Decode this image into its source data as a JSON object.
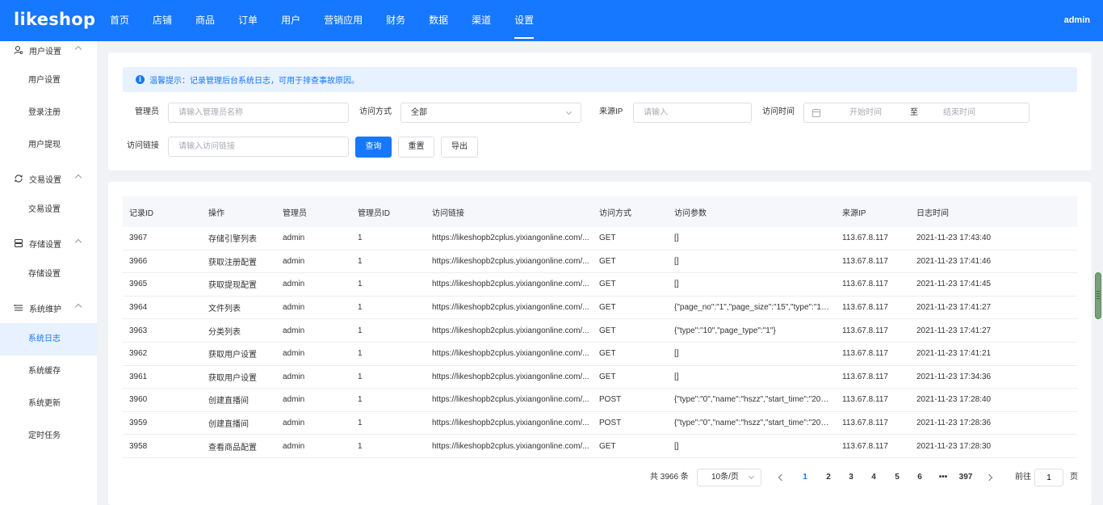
{
  "brand": {
    "logo": "likeshop",
    "accent": "#1677ff"
  },
  "topnav": {
    "items": [
      "首页",
      "店铺",
      "商品",
      "订单",
      "用户",
      "营销应用",
      "财务",
      "数据",
      "渠道",
      "设置"
    ],
    "active": "设置",
    "user": "admin"
  },
  "sidebar": {
    "groups": [
      {
        "label": "用户设置",
        "icon": "user-settings-icon",
        "items": [
          "用户设置",
          "登录注册",
          "用户提现"
        ]
      },
      {
        "label": "交易设置",
        "icon": "sync-icon",
        "items": [
          "交易设置"
        ]
      },
      {
        "label": "存储设置",
        "icon": "database-icon",
        "items": [
          "存储设置"
        ]
      },
      {
        "label": "系统维护",
        "icon": "list-icon",
        "items": [
          "系统日志",
          "系统缓存",
          "系统更新",
          "定时任务"
        ]
      }
    ],
    "active_item": "系统日志"
  },
  "filters": {
    "tip": "温馨提示：记录管理后台系统日志，可用于排查事故原因。",
    "admin_label": "管理员",
    "admin_placeholder": "请输入管理员名称",
    "method_label": "访问方式",
    "method_value": "全部",
    "ip_label": "来源IP",
    "ip_placeholder": "请输入",
    "time_label": "访问时间",
    "time_start": "开始时间",
    "time_sep": "至",
    "time_end": "结束时间",
    "url_label": "访问链接",
    "url_placeholder": "请输入访问链接",
    "search_btn": "查询",
    "reset_btn": "重置",
    "export_btn": "导出"
  },
  "table": {
    "columns": [
      "记录ID",
      "操作",
      "管理员",
      "管理员ID",
      "访问链接",
      "访问方式",
      "访问参数",
      "来源IP",
      "日志时间"
    ],
    "rows": [
      [
        "3967",
        "存储引擎列表",
        "admin",
        "1",
        "https://likeshopb2cplus.yixiangonline.com/...",
        "GET",
        "[]",
        "113.67.8.117",
        "2021-11-23 17:43:40"
      ],
      [
        "3966",
        "获取注册配置",
        "admin",
        "1",
        "https://likeshopb2cplus.yixiangonline.com/...",
        "GET",
        "[]",
        "113.67.8.117",
        "2021-11-23 17:41:46"
      ],
      [
        "3965",
        "获取提现配置",
        "admin",
        "1",
        "https://likeshopb2cplus.yixiangonline.com/...",
        "GET",
        "[]",
        "113.67.8.117",
        "2021-11-23 17:41:45"
      ],
      [
        "3964",
        "文件列表",
        "admin",
        "1",
        "https://likeshopb2cplus.yixiangonline.com/...",
        "GET",
        "{\"page_no\":\"1\",\"page_size\":\"15\",\"type\":\"10...",
        "113.67.8.117",
        "2021-11-23 17:41:27"
      ],
      [
        "3963",
        "分类列表",
        "admin",
        "1",
        "https://likeshopb2cplus.yixiangonline.com/...",
        "GET",
        "{\"type\":\"10\",\"page_type\":\"1\"}",
        "113.67.8.117",
        "2021-11-23 17:41:27"
      ],
      [
        "3962",
        "获取用户设置",
        "admin",
        "1",
        "https://likeshopb2cplus.yixiangonline.com/...",
        "GET",
        "[]",
        "113.67.8.117",
        "2021-11-23 17:41:21"
      ],
      [
        "3961",
        "获取用户设置",
        "admin",
        "1",
        "https://likeshopb2cplus.yixiangonline.com/...",
        "GET",
        "[]",
        "113.67.8.117",
        "2021-11-23 17:34:36"
      ],
      [
        "3960",
        "创建直播间",
        "admin",
        "1",
        "https://likeshopb2cplus.yixiangonline.com/...",
        "POST",
        "{\"type\":\"0\",\"name\":\"hszz\",\"start_time\":\"202...",
        "113.67.8.117",
        "2021-11-23 17:28:40"
      ],
      [
        "3959",
        "创建直播间",
        "admin",
        "1",
        "https://likeshopb2cplus.yixiangonline.com/...",
        "POST",
        "{\"type\":\"0\",\"name\":\"hszz\",\"start_time\":\"202...",
        "113.67.8.117",
        "2021-11-23 17:28:36"
      ],
      [
        "3958",
        "查看商品配置",
        "admin",
        "1",
        "https://likeshopb2cplus.yixiangonline.com/...",
        "GET",
        "[]",
        "113.67.8.117",
        "2021-11-23 17:28:30"
      ]
    ]
  },
  "pagination": {
    "total": "共 3966 条",
    "page_size": "10条/页",
    "pages": [
      "1",
      "2",
      "3",
      "4",
      "5",
      "6",
      "•••",
      "397"
    ],
    "current": "1",
    "goto_label": "前往",
    "goto_value": "1",
    "goto_suffix": "页"
  }
}
